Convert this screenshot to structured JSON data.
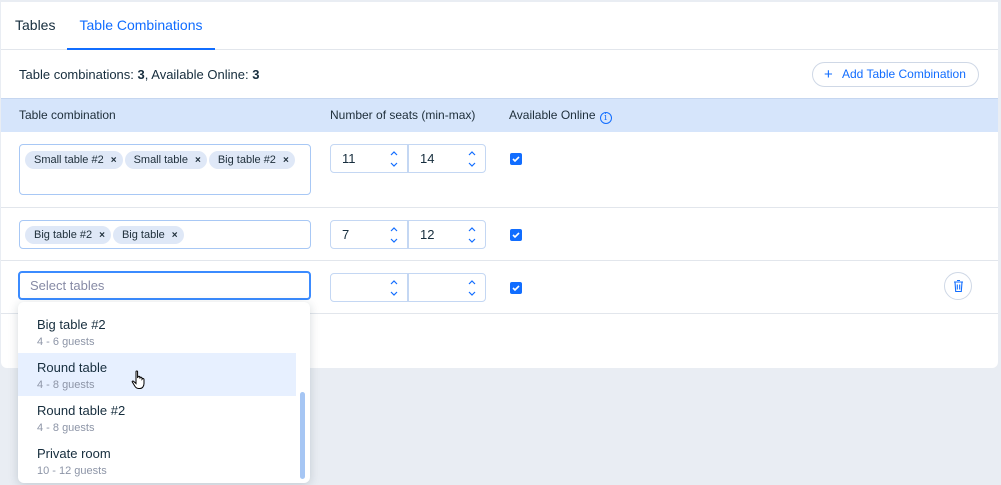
{
  "tabs": [
    {
      "label": "Tables",
      "active": false
    },
    {
      "label": "Table Combinations",
      "active": true
    }
  ],
  "summary": {
    "combinations_label": "Table combinations: ",
    "combinations_count": "3",
    "online_label": ", Available Online: ",
    "online_count": "3"
  },
  "add_button_label": "Add Table Combination",
  "columns": {
    "combination": "Table combination",
    "seats": "Number of seats (min-max)",
    "online": "Available Online"
  },
  "rows": [
    {
      "tables": [
        "Small table #2",
        "Small table",
        "Big table #2"
      ],
      "min": "11",
      "max": "14",
      "available_online": true
    },
    {
      "tables": [
        "Big table #2",
        "Big table"
      ],
      "min": "7",
      "max": "12",
      "available_online": true
    },
    {
      "tables": [],
      "min": "",
      "max": "",
      "available_online": true
    }
  ],
  "select": {
    "placeholder": "Select tables"
  },
  "dropdown_options": [
    {
      "name": "Big table #2",
      "guests": "4 - 6 guests"
    },
    {
      "name": "Round table",
      "guests": "4 - 8 guests",
      "highlighted": true
    },
    {
      "name": "Round table #2",
      "guests": "4 - 8 guests"
    },
    {
      "name": "Private room",
      "guests": "10 - 12 guests"
    }
  ],
  "colors": {
    "accent": "#116dff",
    "header_bg": "#d6e5fb",
    "highlight": "#e7f0ff"
  }
}
